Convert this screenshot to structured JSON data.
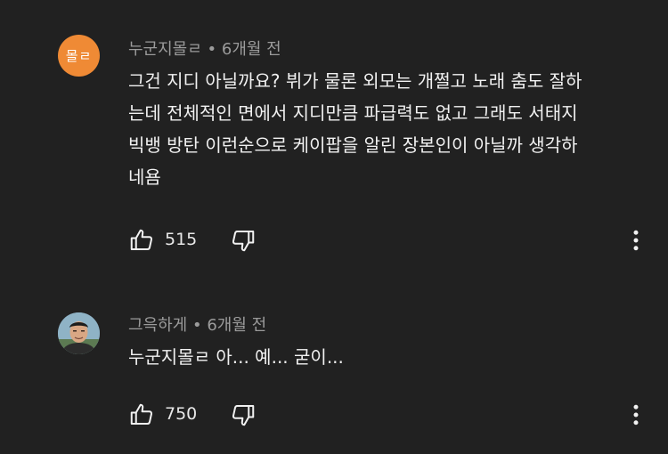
{
  "comments": [
    {
      "avatar_text": "몰ㄹ",
      "avatar_color": "#ef8a35",
      "author": "누군지몰ㄹ",
      "separator": " • ",
      "time": "6개월 전",
      "lines": [
        "그건 지디 아닐까요? 뷔가 물론 외모는 개쩔고 노래 춤도 잘하",
        "는데 전체적인 면에서 지디만큼 파급력도 없고 그래도 서태지",
        "빅뱅 방탄 이런순으로 케이팝을 알린 장본인이 아닐까 생각하",
        "네욤"
      ],
      "likes": "515"
    },
    {
      "avatar_icon": "profile-photo",
      "author": "그윽하게",
      "separator": " • ",
      "time": "6개월 전",
      "lines": [
        "누군지몰ㄹ 아... 예... 굳이..."
      ],
      "likes": "750"
    }
  ]
}
